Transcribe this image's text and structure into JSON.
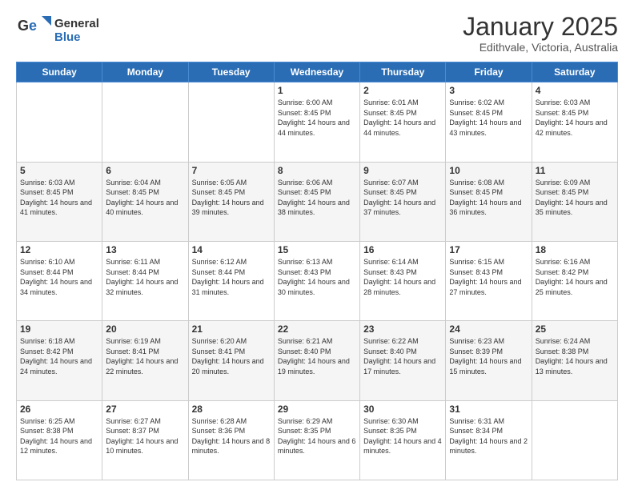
{
  "logo": {
    "line1": "General",
    "line2": "Blue"
  },
  "title": "January 2025",
  "subtitle": "Edithvale, Victoria, Australia",
  "days_of_week": [
    "Sunday",
    "Monday",
    "Tuesday",
    "Wednesday",
    "Thursday",
    "Friday",
    "Saturday"
  ],
  "weeks": [
    [
      {
        "day": "",
        "sunrise": "",
        "sunset": "",
        "daylight": ""
      },
      {
        "day": "",
        "sunrise": "",
        "sunset": "",
        "daylight": ""
      },
      {
        "day": "",
        "sunrise": "",
        "sunset": "",
        "daylight": ""
      },
      {
        "day": "1",
        "sunrise": "Sunrise: 6:00 AM",
        "sunset": "Sunset: 8:45 PM",
        "daylight": "Daylight: 14 hours and 44 minutes."
      },
      {
        "day": "2",
        "sunrise": "Sunrise: 6:01 AM",
        "sunset": "Sunset: 8:45 PM",
        "daylight": "Daylight: 14 hours and 44 minutes."
      },
      {
        "day": "3",
        "sunrise": "Sunrise: 6:02 AM",
        "sunset": "Sunset: 8:45 PM",
        "daylight": "Daylight: 14 hours and 43 minutes."
      },
      {
        "day": "4",
        "sunrise": "Sunrise: 6:03 AM",
        "sunset": "Sunset: 8:45 PM",
        "daylight": "Daylight: 14 hours and 42 minutes."
      }
    ],
    [
      {
        "day": "5",
        "sunrise": "Sunrise: 6:03 AM",
        "sunset": "Sunset: 8:45 PM",
        "daylight": "Daylight: 14 hours and 41 minutes."
      },
      {
        "day": "6",
        "sunrise": "Sunrise: 6:04 AM",
        "sunset": "Sunset: 8:45 PM",
        "daylight": "Daylight: 14 hours and 40 minutes."
      },
      {
        "day": "7",
        "sunrise": "Sunrise: 6:05 AM",
        "sunset": "Sunset: 8:45 PM",
        "daylight": "Daylight: 14 hours and 39 minutes."
      },
      {
        "day": "8",
        "sunrise": "Sunrise: 6:06 AM",
        "sunset": "Sunset: 8:45 PM",
        "daylight": "Daylight: 14 hours and 38 minutes."
      },
      {
        "day": "9",
        "sunrise": "Sunrise: 6:07 AM",
        "sunset": "Sunset: 8:45 PM",
        "daylight": "Daylight: 14 hours and 37 minutes."
      },
      {
        "day": "10",
        "sunrise": "Sunrise: 6:08 AM",
        "sunset": "Sunset: 8:45 PM",
        "daylight": "Daylight: 14 hours and 36 minutes."
      },
      {
        "day": "11",
        "sunrise": "Sunrise: 6:09 AM",
        "sunset": "Sunset: 8:45 PM",
        "daylight": "Daylight: 14 hours and 35 minutes."
      }
    ],
    [
      {
        "day": "12",
        "sunrise": "Sunrise: 6:10 AM",
        "sunset": "Sunset: 8:44 PM",
        "daylight": "Daylight: 14 hours and 34 minutes."
      },
      {
        "day": "13",
        "sunrise": "Sunrise: 6:11 AM",
        "sunset": "Sunset: 8:44 PM",
        "daylight": "Daylight: 14 hours and 32 minutes."
      },
      {
        "day": "14",
        "sunrise": "Sunrise: 6:12 AM",
        "sunset": "Sunset: 8:44 PM",
        "daylight": "Daylight: 14 hours and 31 minutes."
      },
      {
        "day": "15",
        "sunrise": "Sunrise: 6:13 AM",
        "sunset": "Sunset: 8:43 PM",
        "daylight": "Daylight: 14 hours and 30 minutes."
      },
      {
        "day": "16",
        "sunrise": "Sunrise: 6:14 AM",
        "sunset": "Sunset: 8:43 PM",
        "daylight": "Daylight: 14 hours and 28 minutes."
      },
      {
        "day": "17",
        "sunrise": "Sunrise: 6:15 AM",
        "sunset": "Sunset: 8:43 PM",
        "daylight": "Daylight: 14 hours and 27 minutes."
      },
      {
        "day": "18",
        "sunrise": "Sunrise: 6:16 AM",
        "sunset": "Sunset: 8:42 PM",
        "daylight": "Daylight: 14 hours and 25 minutes."
      }
    ],
    [
      {
        "day": "19",
        "sunrise": "Sunrise: 6:18 AM",
        "sunset": "Sunset: 8:42 PM",
        "daylight": "Daylight: 14 hours and 24 minutes."
      },
      {
        "day": "20",
        "sunrise": "Sunrise: 6:19 AM",
        "sunset": "Sunset: 8:41 PM",
        "daylight": "Daylight: 14 hours and 22 minutes."
      },
      {
        "day": "21",
        "sunrise": "Sunrise: 6:20 AM",
        "sunset": "Sunset: 8:41 PM",
        "daylight": "Daylight: 14 hours and 20 minutes."
      },
      {
        "day": "22",
        "sunrise": "Sunrise: 6:21 AM",
        "sunset": "Sunset: 8:40 PM",
        "daylight": "Daylight: 14 hours and 19 minutes."
      },
      {
        "day": "23",
        "sunrise": "Sunrise: 6:22 AM",
        "sunset": "Sunset: 8:40 PM",
        "daylight": "Daylight: 14 hours and 17 minutes."
      },
      {
        "day": "24",
        "sunrise": "Sunrise: 6:23 AM",
        "sunset": "Sunset: 8:39 PM",
        "daylight": "Daylight: 14 hours and 15 minutes."
      },
      {
        "day": "25",
        "sunrise": "Sunrise: 6:24 AM",
        "sunset": "Sunset: 8:38 PM",
        "daylight": "Daylight: 14 hours and 13 minutes."
      }
    ],
    [
      {
        "day": "26",
        "sunrise": "Sunrise: 6:25 AM",
        "sunset": "Sunset: 8:38 PM",
        "daylight": "Daylight: 14 hours and 12 minutes."
      },
      {
        "day": "27",
        "sunrise": "Sunrise: 6:27 AM",
        "sunset": "Sunset: 8:37 PM",
        "daylight": "Daylight: 14 hours and 10 minutes."
      },
      {
        "day": "28",
        "sunrise": "Sunrise: 6:28 AM",
        "sunset": "Sunset: 8:36 PM",
        "daylight": "Daylight: 14 hours and 8 minutes."
      },
      {
        "day": "29",
        "sunrise": "Sunrise: 6:29 AM",
        "sunset": "Sunset: 8:35 PM",
        "daylight": "Daylight: 14 hours and 6 minutes."
      },
      {
        "day": "30",
        "sunrise": "Sunrise: 6:30 AM",
        "sunset": "Sunset: 8:35 PM",
        "daylight": "Daylight: 14 hours and 4 minutes."
      },
      {
        "day": "31",
        "sunrise": "Sunrise: 6:31 AM",
        "sunset": "Sunset: 8:34 PM",
        "daylight": "Daylight: 14 hours and 2 minutes."
      },
      {
        "day": "",
        "sunrise": "",
        "sunset": "",
        "daylight": ""
      }
    ]
  ]
}
